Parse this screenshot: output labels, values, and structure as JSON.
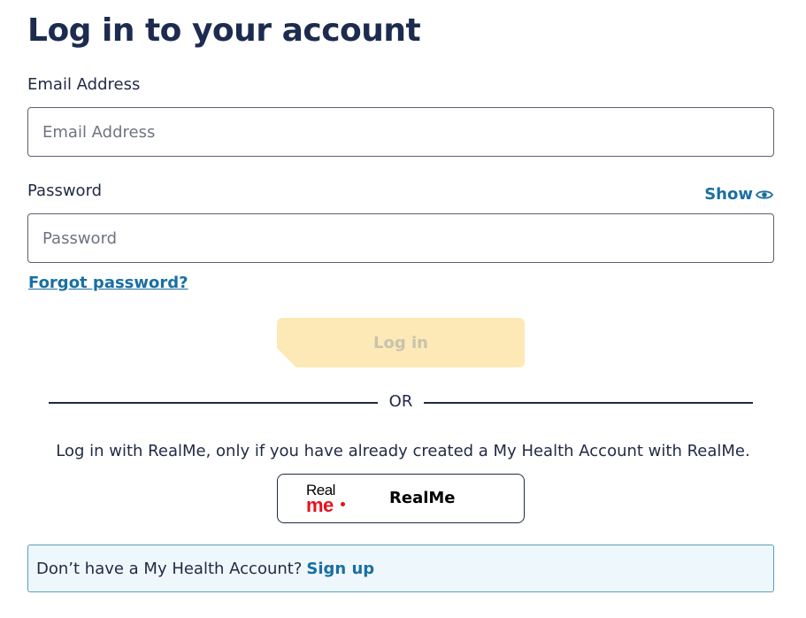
{
  "page": {
    "title": "Log in to your account"
  },
  "form": {
    "email": {
      "label": "Email Address",
      "placeholder": "Email Address",
      "value": ""
    },
    "password": {
      "label": "Password",
      "placeholder": "Password",
      "value": "",
      "show_label": "Show",
      "show_icon": "eye-icon"
    },
    "forgot_label": "Forgot password?",
    "login_label": "Log in",
    "login_enabled": false
  },
  "divider": {
    "label": "OR"
  },
  "realme": {
    "note": "Log in with RealMe, only if you have already created a My Health Account with RealMe.",
    "logo_top": "Real",
    "logo_bottom": "me",
    "button_label": "RealMe"
  },
  "signup": {
    "prompt": "Don’t have a My Health Account?",
    "link_label": "Sign up"
  },
  "colors": {
    "heading": "#1d2b4f",
    "link": "#1a6fa3",
    "login_button_disabled": "#fde9b6",
    "realme_red": "#e3131b",
    "signup_background": "#eef7fb"
  }
}
